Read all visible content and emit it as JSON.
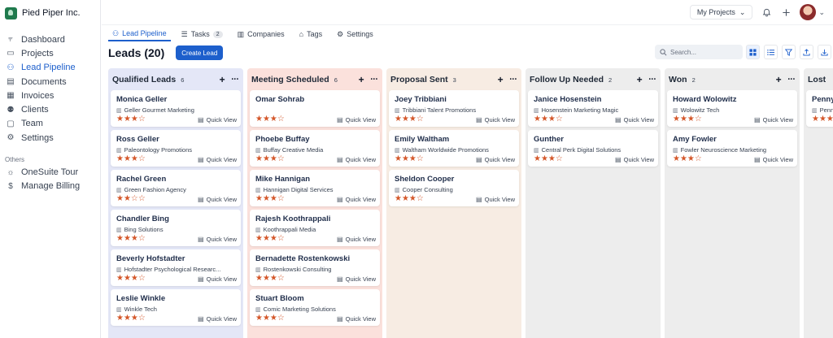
{
  "brand": {
    "name": "Pied Piper Inc."
  },
  "sidebar": {
    "items": [
      {
        "label": "Dashboard",
        "icon": "chart-icon",
        "glyph": "⫧",
        "active": false
      },
      {
        "label": "Projects",
        "icon": "folder-icon",
        "glyph": "▭",
        "active": false
      },
      {
        "label": "Lead Pipeline",
        "icon": "user-icon",
        "glyph": "⚇",
        "active": true
      },
      {
        "label": "Documents",
        "icon": "document-icon",
        "glyph": "▤",
        "active": false
      },
      {
        "label": "Invoices",
        "icon": "invoice-icon",
        "glyph": "▦",
        "active": false
      },
      {
        "label": "Clients",
        "icon": "people-icon",
        "glyph": "⚉",
        "active": false
      },
      {
        "label": "Team",
        "icon": "team-icon",
        "glyph": "▢",
        "active": false
      },
      {
        "label": "Settings",
        "icon": "gear-icon",
        "glyph": "⚙",
        "active": false
      }
    ],
    "others_label": "Others",
    "others": [
      {
        "label": "OneSuite Tour",
        "icon": "sun-icon",
        "glyph": "☼"
      },
      {
        "label": "Manage Billing",
        "icon": "dollar-icon",
        "glyph": "$"
      }
    ]
  },
  "header": {
    "projects_label": "My Projects",
    "bell": "bell-icon",
    "plus": "plus-icon"
  },
  "tabs": [
    {
      "label": "Lead Pipeline",
      "icon": "user-icon",
      "active": true,
      "badge": ""
    },
    {
      "label": "Tasks",
      "icon": "list-icon",
      "active": false,
      "badge": "2"
    },
    {
      "label": "Companies",
      "icon": "bar-chart-icon",
      "active": false,
      "badge": ""
    },
    {
      "label": "Tags",
      "icon": "tag-icon",
      "active": false,
      "badge": ""
    },
    {
      "label": "Settings",
      "icon": "gear-icon",
      "active": false,
      "badge": ""
    }
  ],
  "main": {
    "title": "Leads (20)",
    "create_label": "Create Lead",
    "search_placeholder": "Search..."
  },
  "quick_view_label": "Quick View",
  "colors": {
    "accent": "#1d5fcc",
    "star": "#d4572a"
  },
  "columns": [
    {
      "title": "Qualified Leads",
      "count": "6",
      "bg": "#e4e7f7",
      "show_actions": true,
      "cards": [
        {
          "name": "Monica Geller",
          "company": "Geller Gourmet Marketing",
          "rating": 3
        },
        {
          "name": "Ross Geller",
          "company": "Paleontology Promotions",
          "rating": 3
        },
        {
          "name": "Rachel Green",
          "company": "Green Fashion Agency",
          "rating": 2
        },
        {
          "name": "Chandler Bing",
          "company": "Bing Solutions",
          "rating": 3
        },
        {
          "name": "Beverly Hofstadter",
          "company": "Hofstadter Psychological Researc...",
          "rating": 3
        },
        {
          "name": "Leslie Winkle",
          "company": "Winkle Tech",
          "rating": 3
        }
      ]
    },
    {
      "title": "Meeting Scheduled",
      "count": "6",
      "bg": "#fbe1dc",
      "show_actions": true,
      "cards": [
        {
          "name": "Omar Sohrab",
          "company": "",
          "rating": 3
        },
        {
          "name": "Phoebe Buffay",
          "company": "Buffay Creative Media",
          "rating": 3
        },
        {
          "name": "Mike Hannigan",
          "company": "Hannigan Digital Services",
          "rating": 3
        },
        {
          "name": "Rajesh Koothrappali",
          "company": "Koothrappali Media",
          "rating": 3
        },
        {
          "name": "Bernadette Rostenkowski",
          "company": "Rostenkowski Consulting",
          "rating": 3
        },
        {
          "name": "Stuart Bloom",
          "company": "Comic Marketing Solutions",
          "rating": 3
        }
      ]
    },
    {
      "title": "Proposal Sent",
      "count": "3",
      "bg": "#f7ece3",
      "show_actions": true,
      "cards": [
        {
          "name": "Joey Tribbiani",
          "company": "Tribbiani Talent Promotions",
          "rating": 3
        },
        {
          "name": "Emily Waltham",
          "company": "Waltham Worldwide Promotions",
          "rating": 3
        },
        {
          "name": "Sheldon Cooper",
          "company": "Cooper Consulting",
          "rating": 3
        }
      ]
    },
    {
      "title": "Follow Up Needed",
      "count": "2",
      "bg": "#ededed",
      "show_actions": true,
      "cards": [
        {
          "name": "Janice Hosenstein",
          "company": "Hosenstein Marketing Magic",
          "rating": 3
        },
        {
          "name": "Gunther",
          "company": "Central Perk Digital Solutions",
          "rating": 3
        }
      ]
    },
    {
      "title": "Won",
      "count": "2",
      "bg": "#ededed",
      "show_actions": true,
      "cards": [
        {
          "name": "Howard Wolowitz",
          "company": "Wolowitz Tech",
          "rating": 3
        },
        {
          "name": "Amy Fowler",
          "company": "Fowler Neuroscience Marketing",
          "rating": 3
        }
      ]
    },
    {
      "title": "Lost",
      "count": "",
      "bg": "#ededed",
      "show_actions": false,
      "cards": [
        {
          "name": "Penny",
          "company": "Penn",
          "rating": 3
        }
      ]
    }
  ]
}
